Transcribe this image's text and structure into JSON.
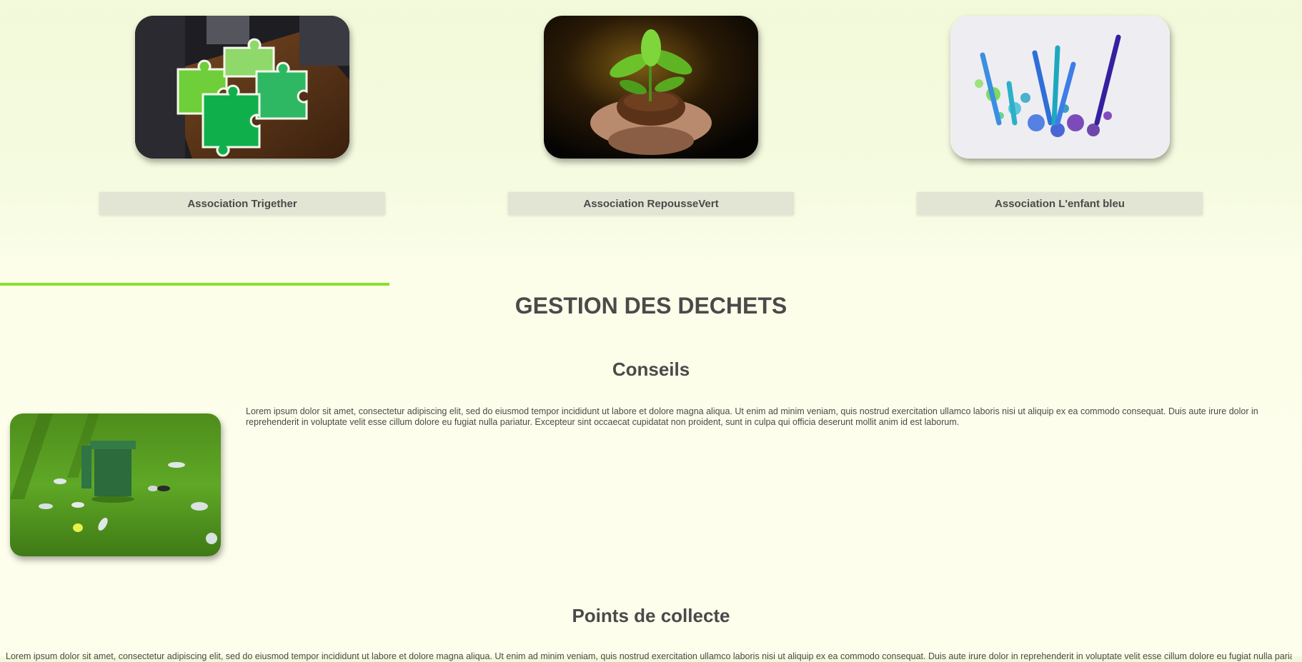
{
  "associations": [
    {
      "name": "Association Trigether",
      "photo_icon": "puzzle-hands-photo"
    },
    {
      "name": "Association RepousseVert",
      "photo_icon": "plant-in-hands-photo"
    },
    {
      "name": "Association L'enfant bleu",
      "photo_icon": "colored-pencils-photo"
    }
  ],
  "section": {
    "title": "GESTION DES DECHETS",
    "accent_color": "#89e12e"
  },
  "conseils": {
    "title": "Conseils",
    "photo_icon": "trash-bin-on-grass-photo",
    "text": "Lorem ipsum dolor sit amet, consectetur adipiscing elit, sed do eiusmod tempor incididunt ut labore et dolore magna aliqua. Ut enim ad minim veniam, quis nostrud exercitation ullamco laboris nisi ut aliquip ex ea commodo consequat. Duis aute irure dolor in reprehenderit in voluptate velit esse cillum dolore eu fugiat nulla pariatur. Excepteur sint occaecat cupidatat non proident, sunt in culpa qui officia deserunt mollit anim id est laborum."
  },
  "collecte": {
    "title": "Points de collecte",
    "text": "Lorem ipsum dolor sit amet, consectetur adipiscing elit, sed do eiusmod tempor incididunt ut labore et dolore magna aliqua. Ut enim ad minim veniam, quis nostrud exercitation ullamco laboris nisi ut aliquip ex ea commodo consequat. Duis aute irure dolor in reprehenderit in voluptate velit esse cillum dolore eu fugiat nulla pariatur."
  }
}
